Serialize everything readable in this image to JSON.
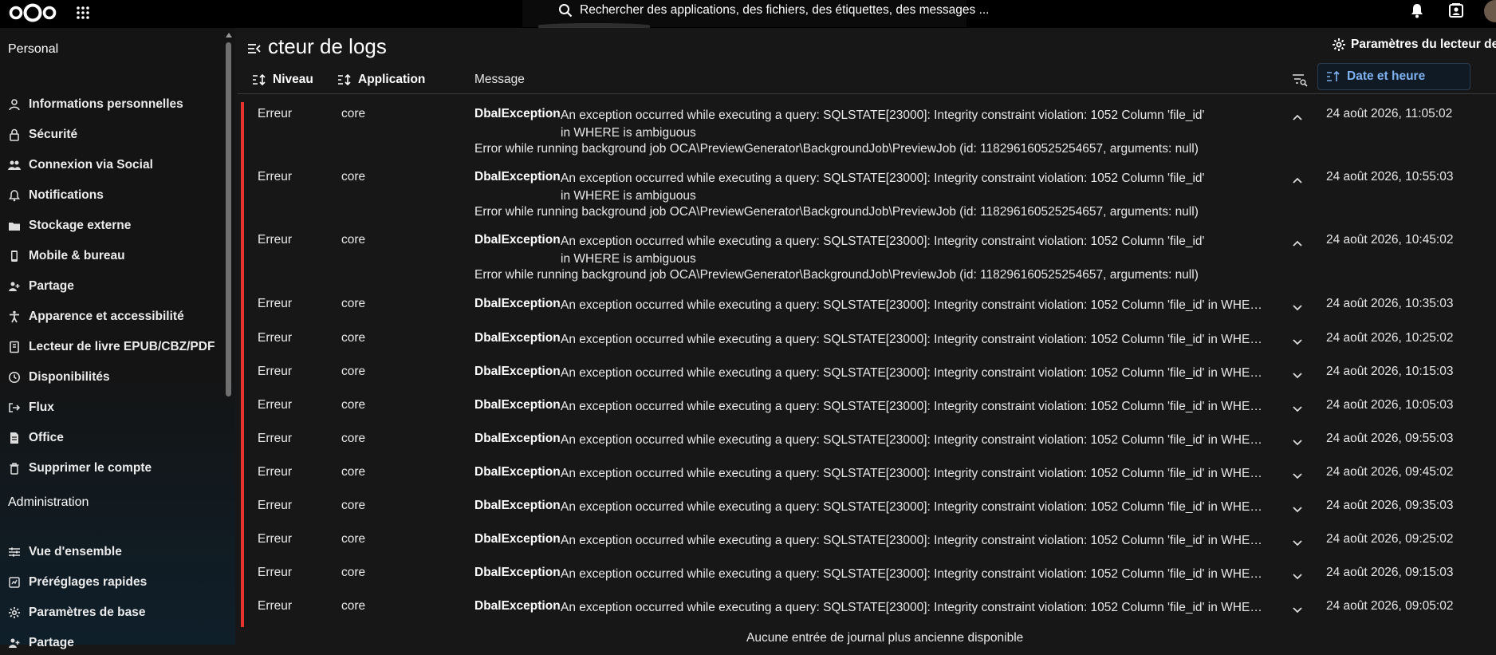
{
  "search": {
    "placeholder": "Rechercher des applications, des fichiers, des étiquettes, des messages ..."
  },
  "sidebar": {
    "personal_title": "Personal",
    "personal_items": [
      {
        "label": "Informations personnelles",
        "icon": "user-icon"
      },
      {
        "label": "Sécurité",
        "icon": "lock-icon"
      },
      {
        "label": "Connexion via Social",
        "icon": "people-icon"
      },
      {
        "label": "Notifications",
        "icon": "bell-icon"
      },
      {
        "label": "Stockage externe",
        "icon": "storage-icon"
      },
      {
        "label": "Mobile & bureau",
        "icon": "phone-icon"
      },
      {
        "label": "Partage",
        "icon": "share-icon"
      },
      {
        "label": "Apparence et accessibilité",
        "icon": "accessibility-icon"
      },
      {
        "label": "Lecteur de livre EPUB/CBZ/PDF",
        "icon": "book-icon"
      },
      {
        "label": "Disponibilités",
        "icon": "clock-icon"
      },
      {
        "label": "Flux",
        "icon": "login-icon"
      },
      {
        "label": "Office",
        "icon": "document-icon"
      },
      {
        "label": "Supprimer le compte",
        "icon": "trash-icon"
      }
    ],
    "admin_title": "Administration",
    "admin_items": [
      {
        "label": "Vue d'ensemble",
        "icon": "sliders-icon"
      },
      {
        "label": "Préréglages rapides",
        "icon": "presets-icon"
      },
      {
        "label": "Paramètres de base",
        "icon": "gear-icon"
      },
      {
        "label": "Partage",
        "icon": "share-icon"
      }
    ]
  },
  "main": {
    "title": "cteur de logs",
    "settings_label": "Paramètres du lecteur de l",
    "columns": {
      "level": "Niveau",
      "app": "Application",
      "message": "Message",
      "date": "Date et heure"
    },
    "footer": "Aucune entrée de journal plus ancienne disponible"
  },
  "colors": {
    "error_bar": "#e9322d",
    "accent": "#7fb2f0"
  },
  "logs": [
    {
      "level": "Erreur",
      "app": "core",
      "exception": "DbalException",
      "message": "An exception occurred while executing a query: SQLSTATE[23000]: Integrity constraint violation: 1052 Column 'file_id' in WHERE is ambiguous",
      "detail": "Error while running background job OCA\\PreviewGenerator\\BackgroundJob\\PreviewJob (id: 118296160525254657, arguments: null)",
      "date": "24 août 2026, 11:05:02",
      "expanded": true
    },
    {
      "level": "Erreur",
      "app": "core",
      "exception": "DbalException",
      "message": "An exception occurred while executing a query: SQLSTATE[23000]: Integrity constraint violation: 1052 Column 'file_id' in WHERE is ambiguous",
      "detail": "Error while running background job OCA\\PreviewGenerator\\BackgroundJob\\PreviewJob (id: 118296160525254657, arguments: null)",
      "date": "24 août 2026, 10:55:03",
      "expanded": true
    },
    {
      "level": "Erreur",
      "app": "core",
      "exception": "DbalException",
      "message": "An exception occurred while executing a query: SQLSTATE[23000]: Integrity constraint violation: 1052 Column 'file_id' in WHERE is ambiguous",
      "detail": "Error while running background job OCA\\PreviewGenerator\\BackgroundJob\\PreviewJob (id: 118296160525254657, arguments: null)",
      "date": "24 août 2026, 10:45:02",
      "expanded": true
    },
    {
      "level": "Erreur",
      "app": "core",
      "exception": "DbalException",
      "message": "An exception occurred while executing a query: SQLSTATE[23000]: Integrity constraint violation: 1052 Column 'file_id' in WHERE is am...",
      "date": "24 août 2026, 10:35:03",
      "expanded": false
    },
    {
      "level": "Erreur",
      "app": "core",
      "exception": "DbalException",
      "message": "An exception occurred while executing a query: SQLSTATE[23000]: Integrity constraint violation: 1052 Column 'file_id' in WHERE is am...",
      "date": "24 août 2026, 10:25:02",
      "expanded": false
    },
    {
      "level": "Erreur",
      "app": "core",
      "exception": "DbalException",
      "message": "An exception occurred while executing a query: SQLSTATE[23000]: Integrity constraint violation: 1052 Column 'file_id' in WHERE is am...",
      "date": "24 août 2026, 10:15:03",
      "expanded": false
    },
    {
      "level": "Erreur",
      "app": "core",
      "exception": "DbalException",
      "message": "An exception occurred while executing a query: SQLSTATE[23000]: Integrity constraint violation: 1052 Column 'file_id' in WHERE is am...",
      "date": "24 août 2026, 10:05:03",
      "expanded": false
    },
    {
      "level": "Erreur",
      "app": "core",
      "exception": "DbalException",
      "message": "An exception occurred while executing a query: SQLSTATE[23000]: Integrity constraint violation: 1052 Column 'file_id' in WHERE is am...",
      "date": "24 août 2026, 09:55:03",
      "expanded": false
    },
    {
      "level": "Erreur",
      "app": "core",
      "exception": "DbalException",
      "message": "An exception occurred while executing a query: SQLSTATE[23000]: Integrity constraint violation: 1052 Column 'file_id' in WHERE is am...",
      "date": "24 août 2026, 09:45:02",
      "expanded": false
    },
    {
      "level": "Erreur",
      "app": "core",
      "exception": "DbalException",
      "message": "An exception occurred while executing a query: SQLSTATE[23000]: Integrity constraint violation: 1052 Column 'file_id' in WHERE is am...",
      "date": "24 août 2026, 09:35:03",
      "expanded": false
    },
    {
      "level": "Erreur",
      "app": "core",
      "exception": "DbalException",
      "message": "An exception occurred while executing a query: SQLSTATE[23000]: Integrity constraint violation: 1052 Column 'file_id' in WHERE is am...",
      "date": "24 août 2026, 09:25:02",
      "expanded": false
    },
    {
      "level": "Erreur",
      "app": "core",
      "exception": "DbalException",
      "message": "An exception occurred while executing a query: SQLSTATE[23000]: Integrity constraint violation: 1052 Column 'file_id' in WHERE is am...",
      "date": "24 août 2026, 09:15:03",
      "expanded": false
    },
    {
      "level": "Erreur",
      "app": "core",
      "exception": "DbalException",
      "message": "An exception occurred while executing a query: SQLSTATE[23000]: Integrity constraint violation: 1052 Column 'file_id' in WHERE is am...",
      "date": "24 août 2026, 09:05:02",
      "expanded": false
    }
  ]
}
